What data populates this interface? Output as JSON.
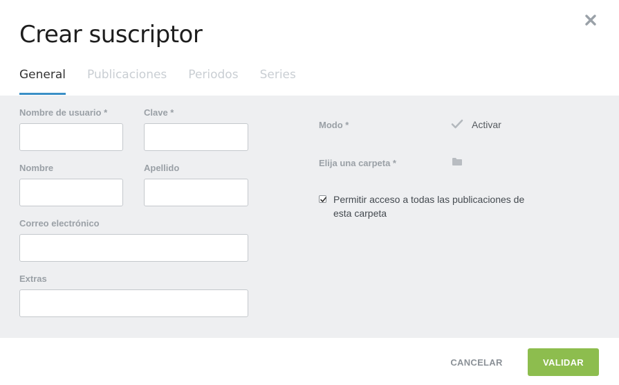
{
  "dialog": {
    "title": "Crear suscriptor",
    "close_icon": "close-icon"
  },
  "tabs": [
    {
      "label": "General",
      "active": true
    },
    {
      "label": "Publicaciones",
      "active": false
    },
    {
      "label": "Periodos",
      "active": false
    },
    {
      "label": "Series",
      "active": false
    }
  ],
  "form": {
    "username_label": "Nombre de usuario *",
    "username_value": "",
    "password_label": "Clave *",
    "password_value": "",
    "firstname_label": "Nombre",
    "firstname_value": "",
    "lastname_label": "Apellido",
    "lastname_value": "",
    "email_label": "Correo electrónico",
    "email_value": "",
    "extras_label": "Extras",
    "extras_value": ""
  },
  "settings": {
    "mode_label": "Modo *",
    "mode_value": "Activar",
    "mode_icon": "checkmark-icon",
    "folder_label": "Elija una carpeta *",
    "folder_icon": "folder-icon",
    "folder_value": "",
    "permission_checked": true,
    "permission_text": "Permitir acceso a todas las publicaciones de esta carpeta"
  },
  "footer": {
    "cancel_label": "CANCELAR",
    "validate_label": "VALIDAR"
  },
  "colors": {
    "accent_tab": "#3a8fc6",
    "validate_button": "#8dbd4e",
    "panel_background": "#eeeff1"
  }
}
